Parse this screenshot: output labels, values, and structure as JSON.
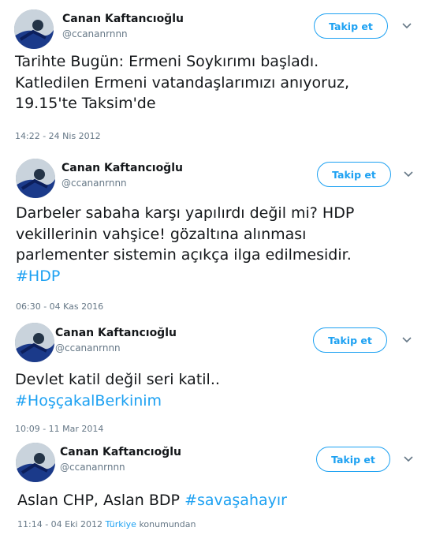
{
  "tweets": [
    {
      "name": "Canan Kaftancıoğlu",
      "handle": "@ccananrnnn",
      "follow_label": "Takip et",
      "lines": [
        "Tarihte Bugün: Ermeni Soykırımı başladı.",
        "Katledilen Ermeni vatandaşlarımızı anıyoruz,",
        "19.15'te Taksim'de"
      ],
      "timestamp": "14:22 - 24 Nis 2012"
    },
    {
      "name": "Canan Kaftancıoğlu",
      "handle": "@ccananrnnn",
      "follow_label": "Takip et",
      "lines": [
        "Darbeler sabaha karşı yapılırdı değil mi? HDP",
        "vekillerinin vahşice! gözaltına alınması",
        "parlementer sistemin açıkça ilga edilmesidir."
      ],
      "hashtag": "#HDP",
      "timestamp": "06:30 - 04 Kas 2016"
    },
    {
      "name": "Canan Kaftancıoğlu",
      "handle": "@ccananrnnn",
      "follow_label": "Takip et",
      "lines": [
        "Devlet katil değil seri katil.."
      ],
      "hashtag": "#HoşçakalBerkinim",
      "timestamp": "10:09 - 11 Mar 2014"
    },
    {
      "name": "Canan Kaftancıoğlu",
      "handle": "@ccananrnnn",
      "follow_label": "Takip et",
      "text": "Aslan CHP, Aslan BDP ",
      "hashtag": "#savaşahayır",
      "timestamp": "11:14 - 04 Eki 2012",
      "location": "Türkiye",
      "location_suffix": " konumundan"
    }
  ],
  "colors": {
    "accent": "#1da1f2",
    "secondary_text": "#657786",
    "primary_text": "#14171a"
  },
  "icons": {
    "menu": "chevron-down-icon"
  }
}
